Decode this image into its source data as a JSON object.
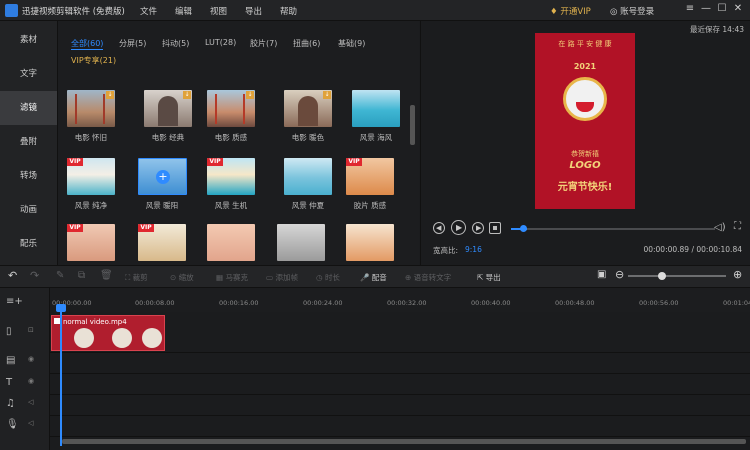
{
  "app": {
    "title": "迅捷视频剪辑软件 (免费版)"
  },
  "menu": [
    "文件",
    "编辑",
    "视图",
    "导出",
    "帮助"
  ],
  "header": {
    "vip": "开通VIP",
    "account": "账号登录"
  },
  "window_controls": [
    "—",
    "☐",
    "✕"
  ],
  "sidebar": [
    "素材",
    "文字",
    "滤镜",
    "叠附",
    "转场",
    "动画",
    "配乐"
  ],
  "library": {
    "tabs": [
      "全部(60)",
      "分屏(5)",
      "抖动(5)",
      "LUT(28)",
      "胶片(7)",
      "扭曲(6)",
      "基础(9)"
    ],
    "vip_tab": "VIP专享(21)",
    "items": [
      {
        "label": "电影 怀旧"
      },
      {
        "label": "电影 经典"
      },
      {
        "label": "电影 质感"
      },
      {
        "label": "电影 暖色"
      },
      {
        "label": "风景 海风"
      },
      {
        "label": "风景 纯净"
      },
      {
        "label": "风景 暖阳"
      },
      {
        "label": "风景 生机"
      },
      {
        "label": "风景 仲夏"
      },
      {
        "label": "胶片 质感"
      }
    ]
  },
  "preview": {
    "last_save": "最近保存 14:43",
    "poster_top": "在 路 平 安 健 康",
    "poster_year": "2021",
    "poster_mid": "恭贺新禧",
    "poster_logo": "LOGO",
    "poster_main": "元宵节快乐!",
    "aspect_label": "宽高比:",
    "aspect_value": "9:16",
    "time_current": "00:00:00.89",
    "time_total": "00:00:10.84",
    "time_sep": " / ",
    "progress": 0.08
  },
  "toolbar": [
    "裁剪",
    "缩放",
    "马赛克",
    "添加帧",
    "时长",
    "配音",
    "语音转文字",
    "导出"
  ],
  "timeline": {
    "ticks": [
      "00:00:00.00",
      "00:00:08.00",
      "00:00:16.00",
      "00:00:24.00",
      "00:00:32.00",
      "00:00:40.00",
      "00:00:48.00",
      "00:00:56.00",
      "00:01:04"
    ],
    "clip_label": "normal video.mp4"
  },
  "colors": {
    "accent": "#2f8bff",
    "vip": "#e0b24e",
    "poster": "#b11226"
  }
}
